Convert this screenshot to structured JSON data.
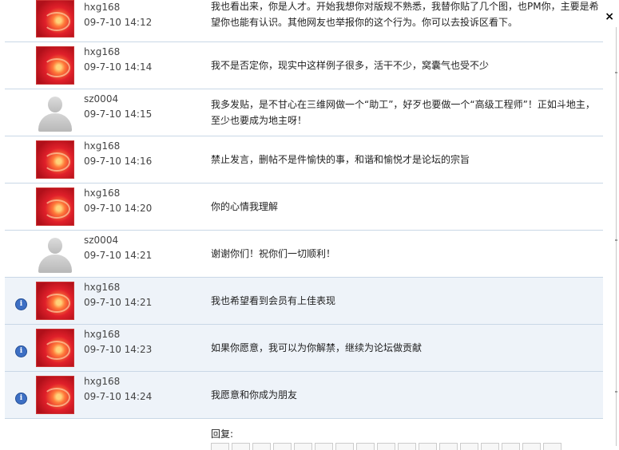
{
  "close_glyph": "×",
  "info_glyph": "i",
  "posts": [
    {
      "user": "hxg168",
      "date": "09-7-10 14:12",
      "avatar": "red",
      "highlight": false,
      "text": "我也看出来，你是人才。开始我想你对版规不熟悉，我替你贴了几个图，也PM你，主要是希望你也能有认识。其他网友也举报你的这个行为。你可以去投诉区看下。"
    },
    {
      "user": "hxg168",
      "date": "09-7-10 14:14",
      "avatar": "red",
      "highlight": false,
      "text": "我不是否定你，现实中这样例子很多，活干不少，窝囊气也受不少"
    },
    {
      "user": "sz0004",
      "date": "09-7-10 14:15",
      "avatar": "gray",
      "highlight": false,
      "text": "我多发贴，是不甘心在三维网做一个“助工”，好歹也要做一个“高级工程师”！正如斗地主，至少也要成为地主呀！"
    },
    {
      "user": "hxg168",
      "date": "09-7-10 14:16",
      "avatar": "red",
      "highlight": false,
      "text": "禁止发言，删帖不是件愉快的事，和谐和愉悦才是论坛的宗旨"
    },
    {
      "user": "hxg168",
      "date": "09-7-10 14:20",
      "avatar": "red",
      "highlight": false,
      "text": "你的心情我理解"
    },
    {
      "user": "sz0004",
      "date": "09-7-10 14:21",
      "avatar": "gray",
      "highlight": false,
      "text": "谢谢你们！祝你们一切顺利！"
    },
    {
      "user": "hxg168",
      "date": "09-7-10 14:21",
      "avatar": "red",
      "highlight": true,
      "text": "我也希望看到会员有上佳表现"
    },
    {
      "user": "hxg168",
      "date": "09-7-10 14:23",
      "avatar": "red",
      "highlight": true,
      "text": "如果你愿意，我可以为你解禁，继续为论坛做贡献"
    },
    {
      "user": "hxg168",
      "date": "09-7-10 14:24",
      "avatar": "red",
      "highlight": true,
      "text": "我愿意和你成为朋友"
    }
  ],
  "reply_label": "回复:"
}
